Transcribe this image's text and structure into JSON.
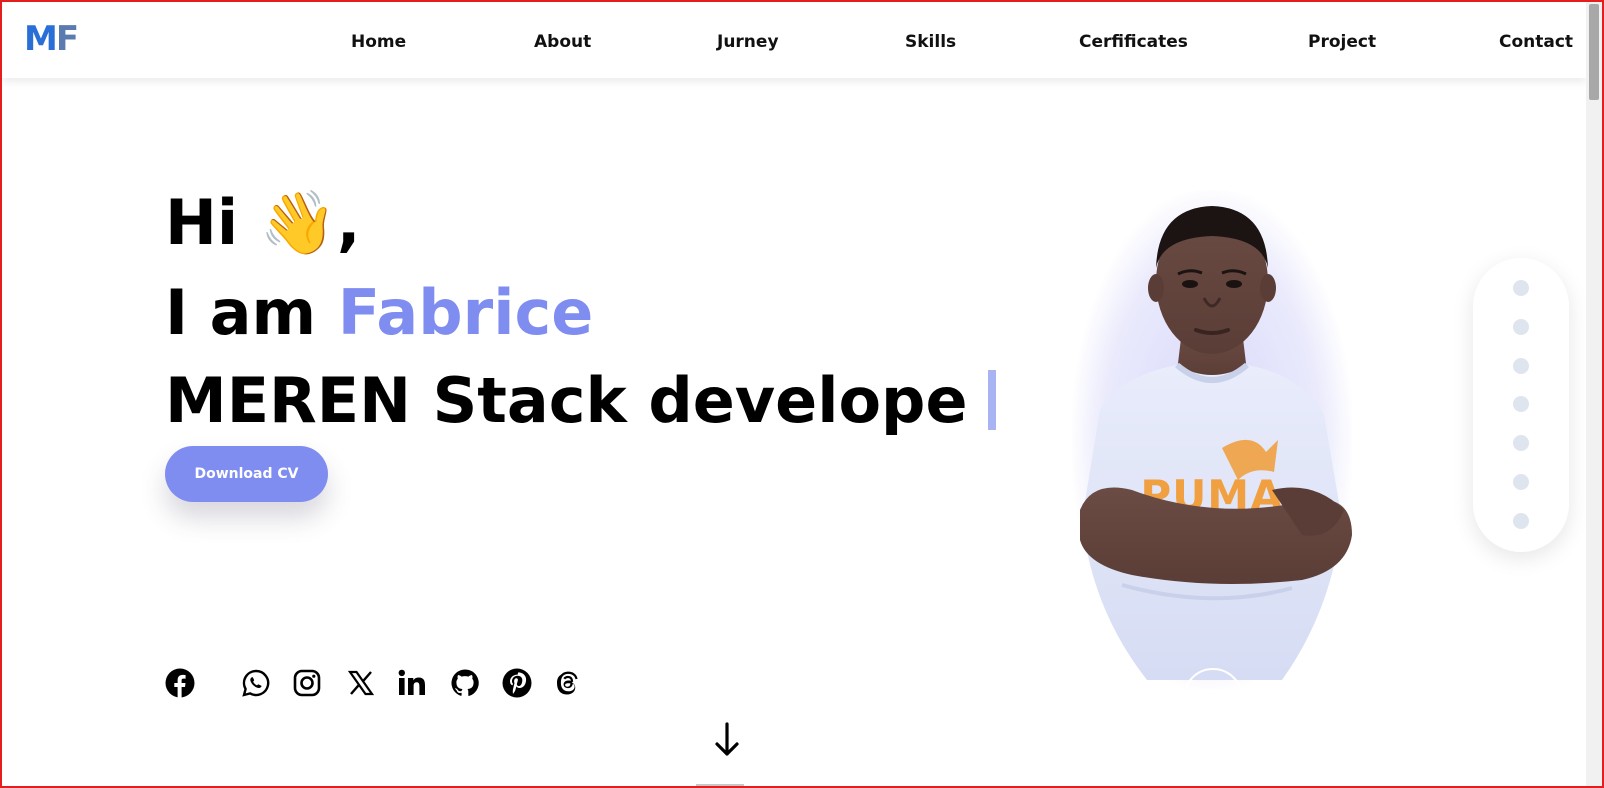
{
  "header": {
    "logo_left": "M",
    "logo_right": "F",
    "nav": [
      {
        "label": "Home"
      },
      {
        "label": "About"
      },
      {
        "label": "Jurney"
      },
      {
        "label": "Skills"
      },
      {
        "label": "Cerfificates"
      },
      {
        "label": "Project"
      },
      {
        "label": "Contact"
      }
    ]
  },
  "hero": {
    "greeting": "Hi 👋,",
    "intro_prefix": "I am",
    "name": "Fabrice",
    "role": "MEREN Stack develope",
    "cv_button": "Download CV"
  },
  "social": [
    {
      "icon": "facebook-icon"
    },
    {
      "icon": "whatsapp-icon"
    },
    {
      "icon": "instagram-icon"
    },
    {
      "icon": "x-icon"
    },
    {
      "icon": "linkedin-icon"
    },
    {
      "icon": "github-icon"
    },
    {
      "icon": "pinterest-icon"
    },
    {
      "icon": "threads-icon"
    }
  ],
  "colors": {
    "accent": "#7f8df0",
    "logo_blue": "#2a6fd6",
    "logo_slate": "#5b7bb0",
    "frame": "#e21e1e"
  },
  "section_dots": 7
}
